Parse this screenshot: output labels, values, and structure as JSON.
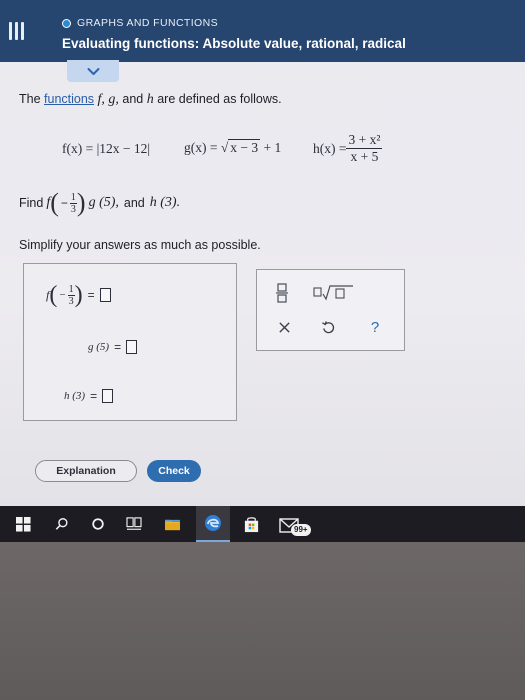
{
  "header": {
    "topic": "GRAPHS AND FUNCTIONS",
    "title": "Evaluating functions: Absolute value, rational, radical"
  },
  "problem": {
    "intro_prefix": "The ",
    "intro_link": "functions",
    "intro_f": "f,",
    "intro_g": "g,",
    "intro_and": "and",
    "intro_h": "h",
    "intro_suffix": "are defined as follows.",
    "f_def": "f(x) = |12x − 12|",
    "g_lhs": "g(x) = ",
    "g_radicand": "x − 3",
    "g_tail": " + 1",
    "h_lhs": "h(x) = ",
    "h_num": "3 + x²",
    "h_den": "x + 5",
    "find_prefix": "Find ",
    "find_f": "f",
    "find_neg": "−",
    "frac_num": "1",
    "frac_den": "3",
    "find_g": "g (5),",
    "find_and": "and",
    "find_h": "h (3).",
    "simplify": "Simplify your answers as much as possible."
  },
  "answers": {
    "f_label": "f",
    "minus": "−",
    "frac_num": "1",
    "frac_den": "3",
    "g_label": "g (5)",
    "h_label": "h (3)",
    "equals": "="
  },
  "buttons": {
    "explanation": "Explanation",
    "check": "Check"
  },
  "taskbar": {
    "badge": "99+"
  },
  "colors": {
    "header": "#26456f",
    "check": "#2e6db0",
    "link": "#2a5da8"
  }
}
